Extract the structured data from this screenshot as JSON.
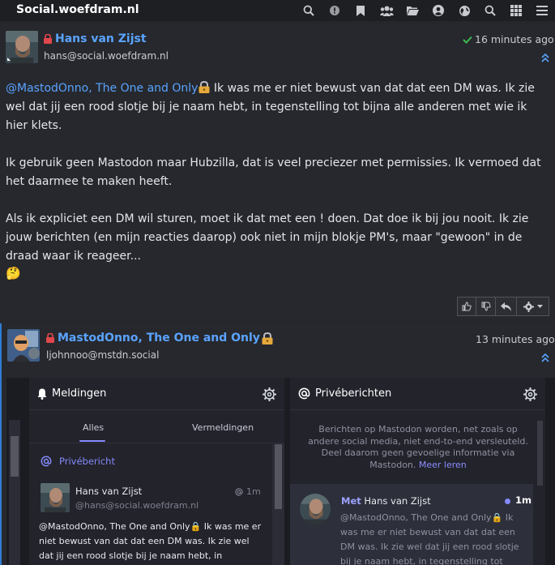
{
  "navbar": {
    "brand": "Social.woefdram.nl",
    "icons": [
      "search-icon",
      "alert-icon",
      "bookmark-icon",
      "users-icon",
      "folder-icon",
      "profile-icon",
      "globe-icon",
      "search-icon",
      "apps-grid-icon",
      "menu-icon"
    ]
  },
  "post1": {
    "author": "Hans van Zijst",
    "handle": "hans@social.woefdram.nl",
    "time": "16 minutes ago",
    "mention": "@MastodOnno, The One and Only",
    "para1_rest": " Ik was me er niet bewust van dat dat een DM was. Ik zie wel dat jij een rood slotje bij je naam hebt, in tegenstelling tot bijna alle anderen met wie ik hier klets.",
    "para2": "Ik gebruik geen Mastodon maar Hubzilla, dat is veel preciezer met permissies. Ik vermoed dat het daarmee te maken heeft.",
    "para3": "Als ik expliciet een DM wil sturen, moet ik dat met een ! doen. Dat doe ik bij jou nooit. Ik zie jouw berichten (en mijn reacties daarop) ook niet in mijn blokje PM's, maar \"gewoon\" in de draad waar ik reageer...",
    "emoji": "🤔"
  },
  "post2": {
    "author": "MastodOnno, The One and Only",
    "handle": "ljohnnoo@mstdn.social",
    "time": "13 minutes ago"
  },
  "screenshot": {
    "left_col": {
      "title": "Meldingen",
      "tabs": [
        "Alles",
        "Vermeldingen"
      ],
      "notif_label": "Privébericht",
      "name": "Hans van Zijst",
      "handle": "@hans@social.woefdram.nl",
      "time": "1m",
      "text": "@MastodOnno, The One and Only🔒 Ik was me er niet bewust van dat dat een DM was. Ik zie wel dat jij een rood slotje bij je naam hebt, in tegenstelling"
    },
    "right_col": {
      "title": "Privéberichten",
      "info": "Berichten op Mastodon worden, net zoals op andere social media, niet end-to-end versleuteld. Deel daarom geen gevoelige informatie via Mastodon.",
      "learn_more": "Meer leren",
      "met": "Met",
      "name": "Hans van Zijst",
      "time": "1m",
      "text": "@MastodOnno, The One and Only🔒 Ik was me er niet bewust van dat dat een DM was. Ik zie wel dat jij een rood slotje bij je naam hebt, in tegenstelling tot bijna"
    }
  },
  "colors": {
    "link": "#5aa3ff",
    "accent_purple": "#858afa",
    "lock_red": "#e0474c",
    "check_green": "#3fb950"
  }
}
